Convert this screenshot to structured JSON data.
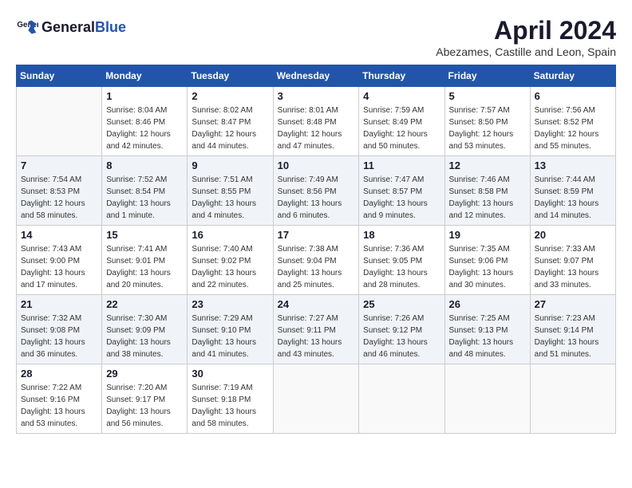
{
  "header": {
    "logo_general": "General",
    "logo_blue": "Blue",
    "title": "April 2024",
    "subtitle": "Abezames, Castille and Leon, Spain"
  },
  "columns": [
    "Sunday",
    "Monday",
    "Tuesday",
    "Wednesday",
    "Thursday",
    "Friday",
    "Saturday"
  ],
  "weeks": [
    [
      {
        "day": "",
        "info": ""
      },
      {
        "day": "1",
        "info": "Sunrise: 8:04 AM\nSunset: 8:46 PM\nDaylight: 12 hours\nand 42 minutes."
      },
      {
        "day": "2",
        "info": "Sunrise: 8:02 AM\nSunset: 8:47 PM\nDaylight: 12 hours\nand 44 minutes."
      },
      {
        "day": "3",
        "info": "Sunrise: 8:01 AM\nSunset: 8:48 PM\nDaylight: 12 hours\nand 47 minutes."
      },
      {
        "day": "4",
        "info": "Sunrise: 7:59 AM\nSunset: 8:49 PM\nDaylight: 12 hours\nand 50 minutes."
      },
      {
        "day": "5",
        "info": "Sunrise: 7:57 AM\nSunset: 8:50 PM\nDaylight: 12 hours\nand 53 minutes."
      },
      {
        "day": "6",
        "info": "Sunrise: 7:56 AM\nSunset: 8:52 PM\nDaylight: 12 hours\nand 55 minutes."
      }
    ],
    [
      {
        "day": "7",
        "info": "Sunrise: 7:54 AM\nSunset: 8:53 PM\nDaylight: 12 hours\nand 58 minutes."
      },
      {
        "day": "8",
        "info": "Sunrise: 7:52 AM\nSunset: 8:54 PM\nDaylight: 13 hours\nand 1 minute."
      },
      {
        "day": "9",
        "info": "Sunrise: 7:51 AM\nSunset: 8:55 PM\nDaylight: 13 hours\nand 4 minutes."
      },
      {
        "day": "10",
        "info": "Sunrise: 7:49 AM\nSunset: 8:56 PM\nDaylight: 13 hours\nand 6 minutes."
      },
      {
        "day": "11",
        "info": "Sunrise: 7:47 AM\nSunset: 8:57 PM\nDaylight: 13 hours\nand 9 minutes."
      },
      {
        "day": "12",
        "info": "Sunrise: 7:46 AM\nSunset: 8:58 PM\nDaylight: 13 hours\nand 12 minutes."
      },
      {
        "day": "13",
        "info": "Sunrise: 7:44 AM\nSunset: 8:59 PM\nDaylight: 13 hours\nand 14 minutes."
      }
    ],
    [
      {
        "day": "14",
        "info": "Sunrise: 7:43 AM\nSunset: 9:00 PM\nDaylight: 13 hours\nand 17 minutes."
      },
      {
        "day": "15",
        "info": "Sunrise: 7:41 AM\nSunset: 9:01 PM\nDaylight: 13 hours\nand 20 minutes."
      },
      {
        "day": "16",
        "info": "Sunrise: 7:40 AM\nSunset: 9:02 PM\nDaylight: 13 hours\nand 22 minutes."
      },
      {
        "day": "17",
        "info": "Sunrise: 7:38 AM\nSunset: 9:04 PM\nDaylight: 13 hours\nand 25 minutes."
      },
      {
        "day": "18",
        "info": "Sunrise: 7:36 AM\nSunset: 9:05 PM\nDaylight: 13 hours\nand 28 minutes."
      },
      {
        "day": "19",
        "info": "Sunrise: 7:35 AM\nSunset: 9:06 PM\nDaylight: 13 hours\nand 30 minutes."
      },
      {
        "day": "20",
        "info": "Sunrise: 7:33 AM\nSunset: 9:07 PM\nDaylight: 13 hours\nand 33 minutes."
      }
    ],
    [
      {
        "day": "21",
        "info": "Sunrise: 7:32 AM\nSunset: 9:08 PM\nDaylight: 13 hours\nand 36 minutes."
      },
      {
        "day": "22",
        "info": "Sunrise: 7:30 AM\nSunset: 9:09 PM\nDaylight: 13 hours\nand 38 minutes."
      },
      {
        "day": "23",
        "info": "Sunrise: 7:29 AM\nSunset: 9:10 PM\nDaylight: 13 hours\nand 41 minutes."
      },
      {
        "day": "24",
        "info": "Sunrise: 7:27 AM\nSunset: 9:11 PM\nDaylight: 13 hours\nand 43 minutes."
      },
      {
        "day": "25",
        "info": "Sunrise: 7:26 AM\nSunset: 9:12 PM\nDaylight: 13 hours\nand 46 minutes."
      },
      {
        "day": "26",
        "info": "Sunrise: 7:25 AM\nSunset: 9:13 PM\nDaylight: 13 hours\nand 48 minutes."
      },
      {
        "day": "27",
        "info": "Sunrise: 7:23 AM\nSunset: 9:14 PM\nDaylight: 13 hours\nand 51 minutes."
      }
    ],
    [
      {
        "day": "28",
        "info": "Sunrise: 7:22 AM\nSunset: 9:16 PM\nDaylight: 13 hours\nand 53 minutes."
      },
      {
        "day": "29",
        "info": "Sunrise: 7:20 AM\nSunset: 9:17 PM\nDaylight: 13 hours\nand 56 minutes."
      },
      {
        "day": "30",
        "info": "Sunrise: 7:19 AM\nSunset: 9:18 PM\nDaylight: 13 hours\nand 58 minutes."
      },
      {
        "day": "",
        "info": ""
      },
      {
        "day": "",
        "info": ""
      },
      {
        "day": "",
        "info": ""
      },
      {
        "day": "",
        "info": ""
      }
    ]
  ]
}
